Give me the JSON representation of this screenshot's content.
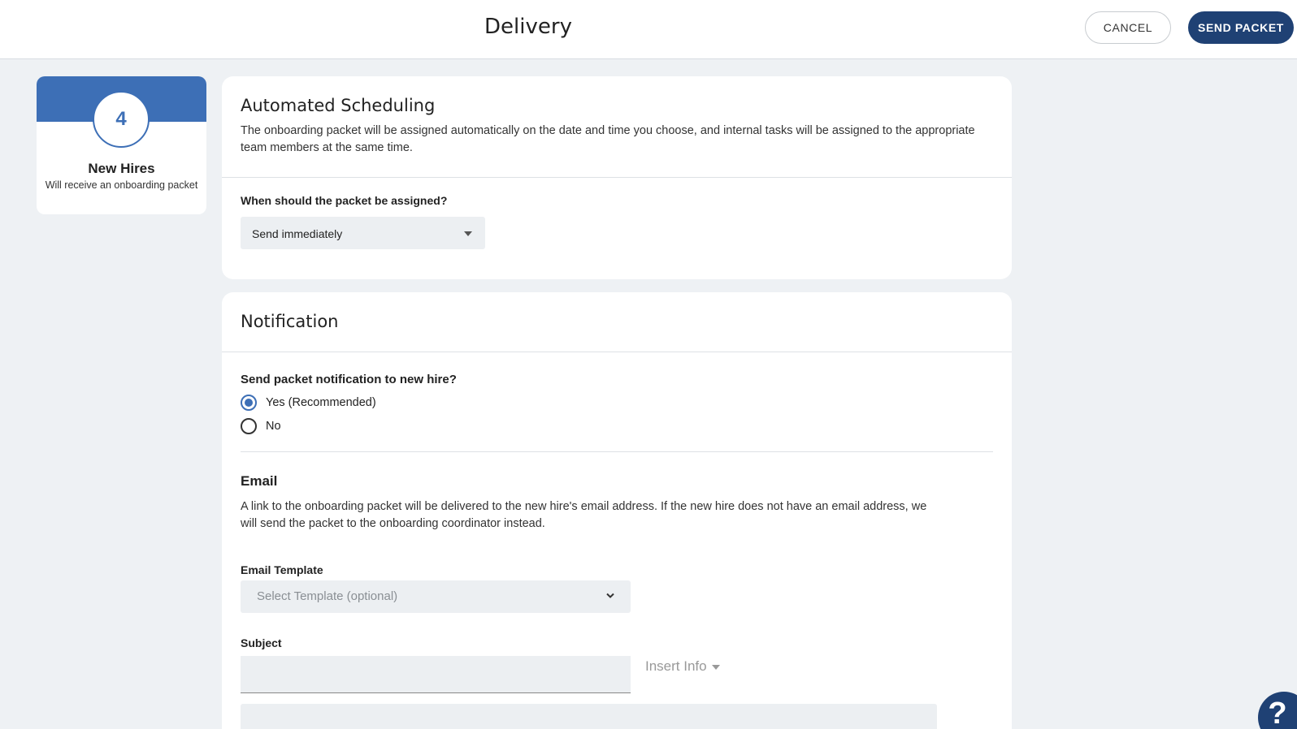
{
  "header": {
    "title": "Delivery",
    "cancel_label": "CANCEL",
    "send_label": "SEND PACKET"
  },
  "summary": {
    "count": "4",
    "label": "New Hires",
    "sub": "Will receive an onboarding packet"
  },
  "scheduling": {
    "title": "Automated Scheduling",
    "description": "The onboarding packet will be assigned automatically on the date and time you choose, and internal tasks will be assigned to the appropriate team members at the same time.",
    "question": "When should the packet be assigned?",
    "selected": "Send immediately"
  },
  "notification": {
    "title": "Notification",
    "question": "Send packet notification to new hire?",
    "options": [
      {
        "label": "Yes (Recommended)",
        "checked": true
      },
      {
        "label": "No",
        "checked": false
      }
    ],
    "email_title": "Email",
    "email_description": "A link to the onboarding packet will be delivered to the new hire's email address. If the new hire does not have an email address, we will send the packet to the onboarding coordinator instead.",
    "template_label": "Email Template",
    "template_placeholder": "Select Template (optional)",
    "subject_label": "Subject",
    "subject_value": "",
    "insert_info": "Insert Info"
  },
  "help": {
    "icon": "help-icon",
    "glyph": "?"
  },
  "colors": {
    "primary": "#1f4174",
    "accent": "#3d6fb6",
    "background": "#eef1f4"
  }
}
